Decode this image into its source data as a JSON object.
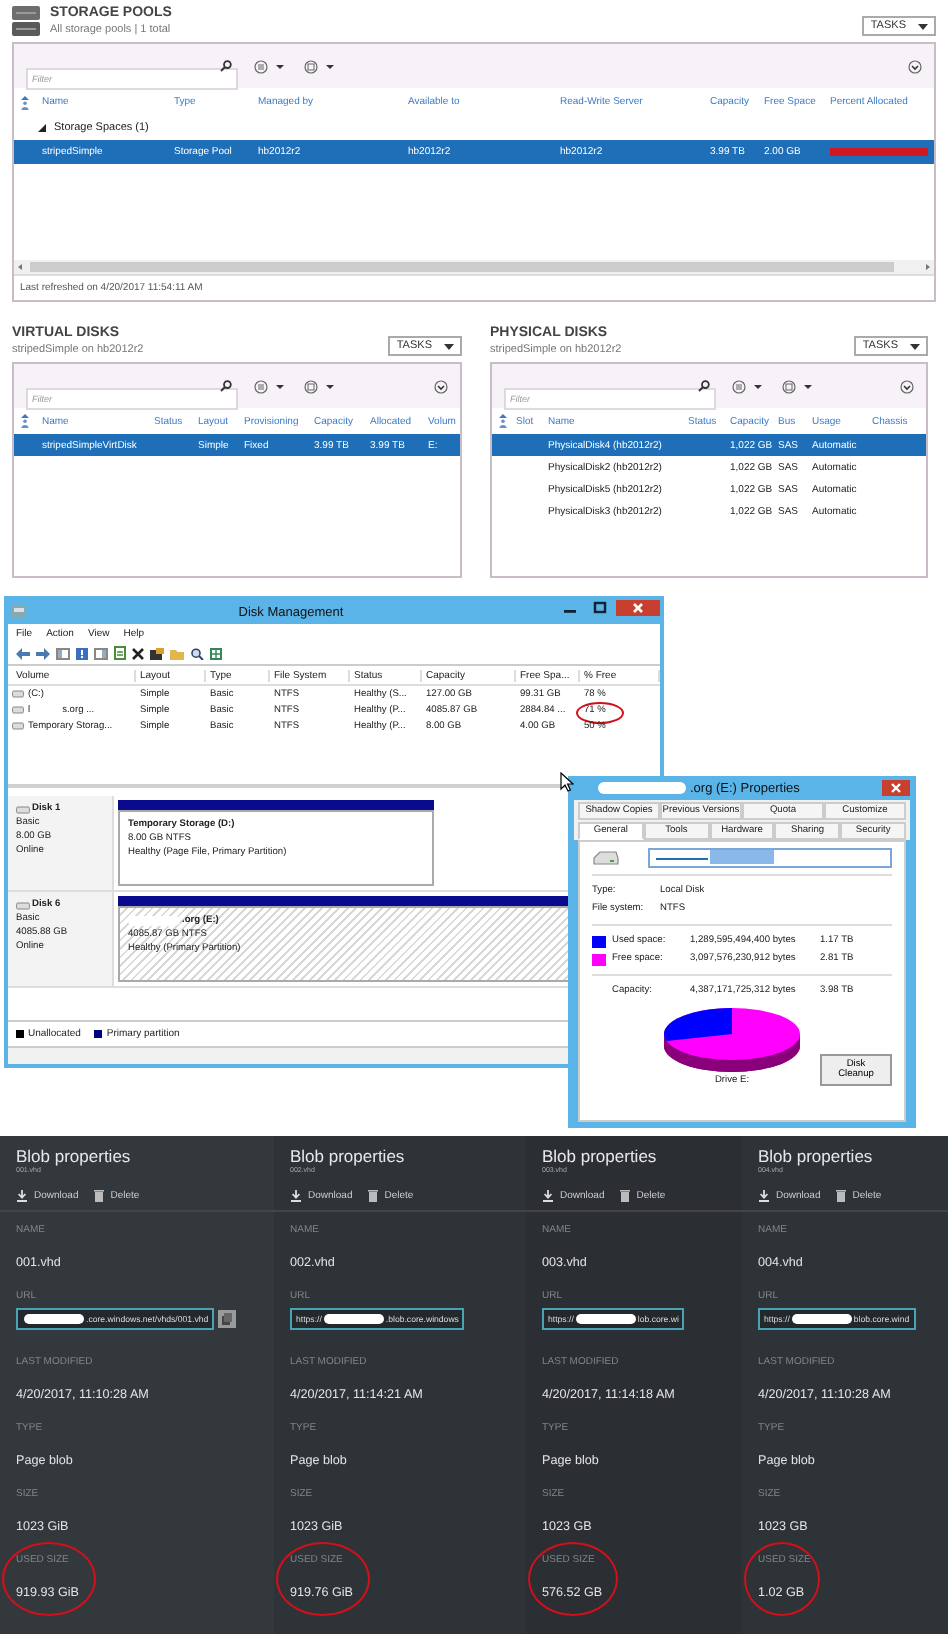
{
  "storage_pools": {
    "title": "STORAGE POOLS",
    "subtitle": "All storage pools | 1 total",
    "tasks": "TASKS",
    "placeholder": "Filter",
    "columns": [
      "Name",
      "Type",
      "Managed by",
      "Available to",
      "Read-Write Server",
      "Capacity",
      "Free Space",
      "Percent Allocated"
    ],
    "group": "Storage Spaces (1)",
    "rows": [
      {
        "selected": true,
        "cells": [
          "stripedSimple",
          "Storage Pool",
          "hb2012r2",
          "hb2012r2",
          "hb2012r2",
          "3.99 TB",
          "2.00 GB"
        ],
        "level": 1
      }
    ],
    "status": "Last refreshed on 4/20/2017 11:54:11 AM"
  },
  "virtual_disks": {
    "title": "VIRTUAL DISKS",
    "subtitle": "stripedSimple on hb2012r2",
    "tasks": "TASKS",
    "placeholder": "Filter",
    "columns": [
      "Name",
      "Status",
      "Layout",
      "Provisioning",
      "Capacity",
      "Allocated",
      "Volum"
    ],
    "rows": [
      {
        "selected": true,
        "cells": [
          "stripedSimpleVirtDisk",
          null,
          "Simple",
          "Fixed",
          "3.99 TB",
          "3.99 TB",
          "E:"
        ]
      }
    ]
  },
  "physical_disks": {
    "title": "PHYSICAL DISKS",
    "subtitle": "stripedSimple on hb2012r2",
    "tasks": "TASKS",
    "placeholder": "Filter",
    "columns": [
      "Slot",
      "Name",
      "Status",
      "Capacity",
      "Bus",
      "Usage",
      "Chassis"
    ],
    "rows": [
      {
        "selected": true,
        "cells": [
          null,
          "PhysicalDisk4 (hb2012r2)",
          null,
          "1,022 GB",
          "SAS",
          "Automatic",
          null
        ]
      },
      {
        "selected": false,
        "cells": [
          null,
          "PhysicalDisk2 (hb2012r2)",
          null,
          "1,022 GB",
          "SAS",
          "Automatic",
          null
        ]
      },
      {
        "selected": false,
        "cells": [
          null,
          "PhysicalDisk5 (hb2012r2)",
          null,
          "1,022 GB",
          "SAS",
          "Automatic",
          null
        ]
      },
      {
        "selected": false,
        "cells": [
          null,
          "PhysicalDisk3 (hb2012r2)",
          null,
          "1,022 GB",
          "SAS",
          "Automatic",
          null
        ]
      }
    ]
  },
  "disk_management": {
    "title": "Disk Management",
    "menu": [
      "File",
      "Action",
      "View",
      "Help"
    ],
    "columns": [
      "Volume",
      "Layout",
      "Type",
      "File System",
      "Status",
      "Capacity",
      "Free Spa...",
      "% Free"
    ],
    "volumes": [
      {
        "name": "(C:)",
        "cells": [
          "Simple",
          "Basic",
          "NTFS",
          "Healthy (S...",
          "127.00 GB",
          "99.31 GB",
          "78 %"
        ]
      },
      {
        "prefix": "l",
        "name": "s.org ...",
        "cells": [
          "Simple",
          "Basic",
          "NTFS",
          "Healthy (P...",
          "4085.87 GB",
          "2884.84 ...",
          "71 %"
        ],
        "circled": true
      },
      {
        "name": "Temporary Storag...",
        "cells": [
          "Simple",
          "Basic",
          "NTFS",
          "Healthy (P...",
          "8.00 GB",
          "4.00 GB",
          "50 %"
        ]
      }
    ],
    "disks": [
      {
        "name": "Disk 1",
        "type": "Basic",
        "size": "8.00 GB",
        "status": "Online",
        "partition": {
          "title": "Temporary Storage  (D:)",
          "size": "8.00 GB NTFS",
          "status": "Healthy (Page File, Primary Partition)",
          "selected": false
        }
      },
      {
        "name": "Disk 6",
        "type": "Basic",
        "size": "4085.88 GB",
        "status": "Online",
        "partition": {
          "title": ".org  (E:)",
          "redacted": true,
          "size": "4085.87 GB NTFS",
          "status": "Healthy (Primary Partition)",
          "selected": true
        }
      }
    ],
    "legend": [
      {
        "label": "Unallocated",
        "color": "#000000"
      },
      {
        "label": "Primary partition",
        "color": "#000080"
      }
    ]
  },
  "properties": {
    "title": ".org (E:) Properties",
    "tab_rows": [
      [
        {
          "label": "Shadow Copies",
          "selected": false
        },
        {
          "label": "Previous Versions",
          "selected": false
        },
        {
          "label": "Quota",
          "selected": false
        },
        {
          "label": "Customize",
          "selected": false
        }
      ],
      [
        {
          "label": "General",
          "selected": true
        },
        {
          "label": "Tools",
          "selected": false
        },
        {
          "label": "Hardware",
          "selected": false
        },
        {
          "label": "Sharing",
          "selected": false
        },
        {
          "label": "Security",
          "selected": false
        }
      ]
    ],
    "info": [
      {
        "label": "Type:",
        "value": "Local Disk"
      },
      {
        "label": "File system:",
        "value": "NTFS"
      }
    ],
    "space": [
      {
        "label": "Used space:",
        "bytes": "1,289,595,494,400 bytes",
        "size": "1.17 TB",
        "color": "#0000ff"
      },
      {
        "label": "Free space:",
        "bytes": "3,097,576,230,912 bytes",
        "size": "2.81 TB",
        "color": "#ff00ff"
      }
    ],
    "capacity": {
      "label": "Capacity:",
      "bytes": "4,387,171,725,312 bytes",
      "size": "3.98 TB"
    },
    "drive": "Drive E:",
    "cleanup": "Disk Cleanup"
  },
  "blobs": [
    {
      "title": "Blob properties",
      "subtitle": "001.vhd",
      "actions": [
        "Download",
        "Delete"
      ],
      "fields": [
        {
          "kind": "text",
          "label": "NAME",
          "value": "001.vhd"
        },
        {
          "kind": "url",
          "label": "URL",
          "suffix": ".core.windows.net/vhds/001.vhd",
          "copy": true
        },
        {
          "kind": "text",
          "label": "LAST MODIFIED",
          "value": "4/20/2017, 11:10:28 AM"
        },
        {
          "kind": "text",
          "label": "TYPE",
          "value": "Page blob"
        },
        {
          "kind": "text",
          "label": "SIZE",
          "value": "1023 GiB"
        },
        {
          "kind": "text",
          "label": "USED SIZE",
          "value": "919.93 GiB",
          "circled": true
        }
      ]
    },
    {
      "title": "Blob properties",
      "subtitle": "002.vhd",
      "actions": [
        "Download",
        "Delete"
      ],
      "fields": [
        {
          "kind": "text",
          "label": "NAME",
          "value": "002.vhd"
        },
        {
          "kind": "url",
          "label": "URL",
          "prefix": "https://",
          "suffix": ".blob.core.windows"
        },
        {
          "kind": "text",
          "label": "LAST MODIFIED",
          "value": "4/20/2017, 11:14:21 AM"
        },
        {
          "kind": "text",
          "label": "TYPE",
          "value": "Page blob"
        },
        {
          "kind": "text",
          "label": "SIZE",
          "value": "1023 GiB"
        },
        {
          "kind": "text",
          "label": "USED SIZE",
          "value": "919.76 GiB",
          "circled": true
        }
      ]
    },
    {
      "title": "Blob properties",
      "subtitle": "003.vhd",
      "actions": [
        "Download",
        "Delete"
      ],
      "fields": [
        {
          "kind": "text",
          "label": "NAME",
          "value": "003.vhd"
        },
        {
          "kind": "url",
          "label": "URL",
          "prefix": "https://",
          "suffix": "lob.core.wi"
        },
        {
          "kind": "text",
          "label": "LAST MODIFIED",
          "value": "4/20/2017, 11:14:18 AM"
        },
        {
          "kind": "text",
          "label": "TYPE",
          "value": "Page blob"
        },
        {
          "kind": "text",
          "label": "SIZE",
          "value": "1023 GB"
        },
        {
          "kind": "text",
          "label": "USED SIZE",
          "value": "576.52 GB",
          "circled": true
        }
      ]
    },
    {
      "title": "Blob properties",
      "subtitle": "004.vhd",
      "actions": [
        "Download",
        "Delete"
      ],
      "fields": [
        {
          "kind": "text",
          "label": "NAME",
          "value": "004.vhd"
        },
        {
          "kind": "url",
          "label": "URL",
          "prefix": "https://",
          "suffix": "blob.core.wind"
        },
        {
          "kind": "text",
          "label": "LAST MODIFIED",
          "value": "4/20/2017, 11:10:28 AM"
        },
        {
          "kind": "text",
          "label": "TYPE",
          "value": "Page blob"
        },
        {
          "kind": "text",
          "label": "SIZE",
          "value": "1023 GB"
        },
        {
          "kind": "text",
          "label": "USED SIZE",
          "value": "1.02 GB",
          "circled": true
        }
      ]
    }
  ]
}
